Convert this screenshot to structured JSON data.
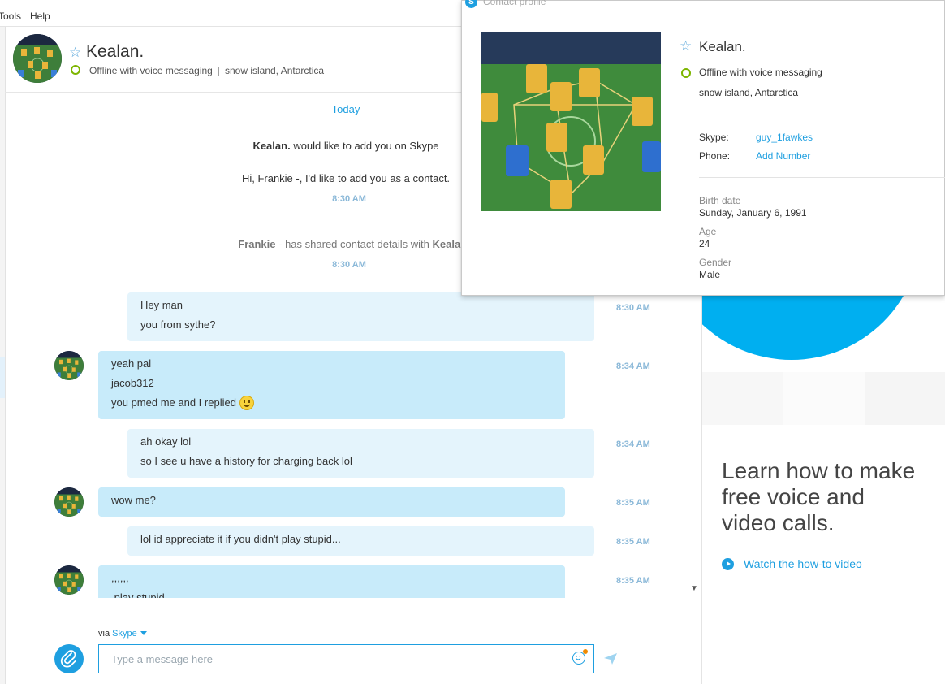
{
  "menu": {
    "tools": "Tools",
    "help": "Help"
  },
  "contact": {
    "name": "Kealan.",
    "status": "Offline with voice messaging",
    "location": "snow island, Antarctica",
    "separator": "|"
  },
  "conversation": {
    "day_label": "Today",
    "request_name": "Kealan.",
    "request_text": "would like to add you on Skype",
    "request_message": "Hi, Frankie -, I'd like to add you as a contact.",
    "request_time": "8:30 AM",
    "shared_sender": "Frankie",
    "shared_text": "- has shared contact details with",
    "shared_recipient": "Kealan.",
    "shared_time": "8:30 AM",
    "messages": [
      {
        "dir": "out",
        "lines": [
          "Hey man",
          "you from sythe?"
        ],
        "time": "8:30 AM"
      },
      {
        "dir": "in",
        "lines": [
          "yeah pal",
          "jacob312",
          "you pmed me and I replied"
        ],
        "time": "8:34 AM"
      },
      {
        "dir": "out",
        "lines": [
          "ah okay lol",
          "so I see u have a history for charging back lol"
        ],
        "time": "8:34 AM"
      },
      {
        "dir": "in",
        "lines": [
          "wow me?"
        ],
        "time": "8:35 AM"
      },
      {
        "dir": "out",
        "lines": [
          "lol id appreciate it if you didn't play stupid..."
        ],
        "time": "8:35 AM"
      },
      {
        "dir": "in",
        "lines": [
          ",,,,,,",
          ",play stupid"
        ],
        "time": "8:35 AM"
      }
    ]
  },
  "compose": {
    "via_label": "via",
    "via_service": "Skype",
    "placeholder": "Type a message here"
  },
  "promo": {
    "line1": "Learn how to make",
    "line2": "free voice and",
    "line3": "video calls.",
    "link": "Watch the how-to video"
  },
  "profile": {
    "window_title": "Contact profile",
    "name": "Kealan.",
    "status": "Offline with voice messaging",
    "location": "snow island, Antarctica",
    "skype_label": "Skype:",
    "skype_value": "guy_1fawkes",
    "phone_label": "Phone:",
    "phone_value": "Add Number",
    "birth_label": "Birth date",
    "birth_value": "Sunday, January 6, 1991",
    "age_label": "Age",
    "age_value": "24",
    "gender_label": "Gender",
    "gender_value": "Male"
  },
  "colors": {
    "accent": "#1e9fe0",
    "online_ring": "#7db500",
    "bubble_in": "#c8ebfa",
    "bubble_out": "#e4f4fc"
  }
}
